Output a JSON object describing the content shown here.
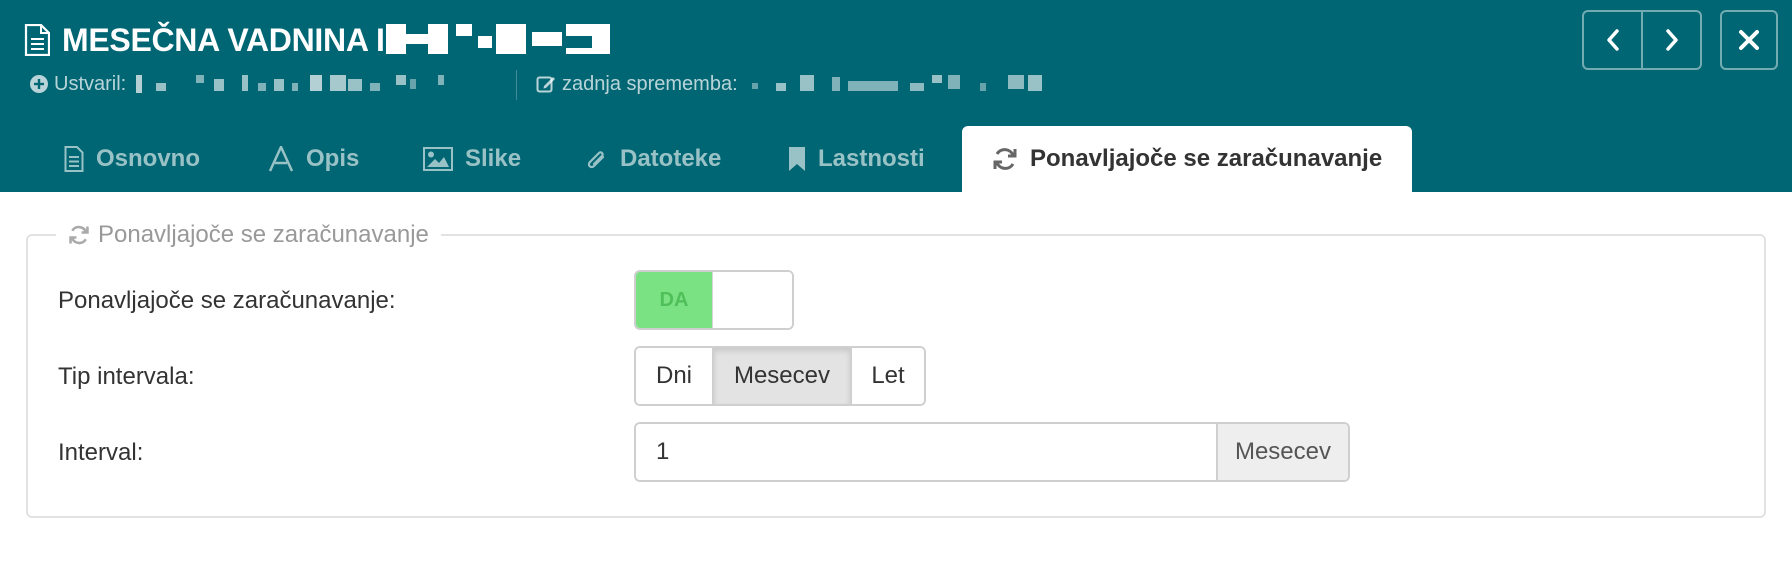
{
  "window": {
    "title": "MESEČNA VADNINA I",
    "created_label": "Ustvaril:",
    "edited_label": "zadnja sprememba:"
  },
  "icons": {
    "doc": "document-icon",
    "created": "plus-circle-icon",
    "edited": "edit-icon",
    "prev": "chevron-left-icon",
    "next": "chevron-right-icon",
    "close": "close-icon"
  },
  "tabs": [
    {
      "label": "Osnovno",
      "icon": "document-icon"
    },
    {
      "label": "Opis",
      "icon": "font-icon"
    },
    {
      "label": "Slike",
      "icon": "image-icon"
    },
    {
      "label": "Datoteke",
      "icon": "paperclip-icon"
    },
    {
      "label": "Lastnosti",
      "icon": "bookmark-icon"
    },
    {
      "label": "Ponavljajoče se zaračunavanje",
      "icon": "refresh-icon",
      "active": true
    }
  ],
  "section": {
    "legend": "Ponavljajoče se zaračunavanje",
    "recurring": {
      "label": "Ponavljajoče se zaračunavanje:",
      "toggle_on_label": "DA",
      "enabled": true
    },
    "interval_type": {
      "label": "Tip intervala:",
      "options": [
        "Dni",
        "Mesecev",
        "Let"
      ],
      "selected": "Mesecev"
    },
    "interval": {
      "label": "Interval:",
      "value": "1",
      "unit": "Mesecev"
    }
  },
  "colors": {
    "header_bg": "#006673",
    "toggle_on": "#7be283",
    "text": "#333333"
  }
}
